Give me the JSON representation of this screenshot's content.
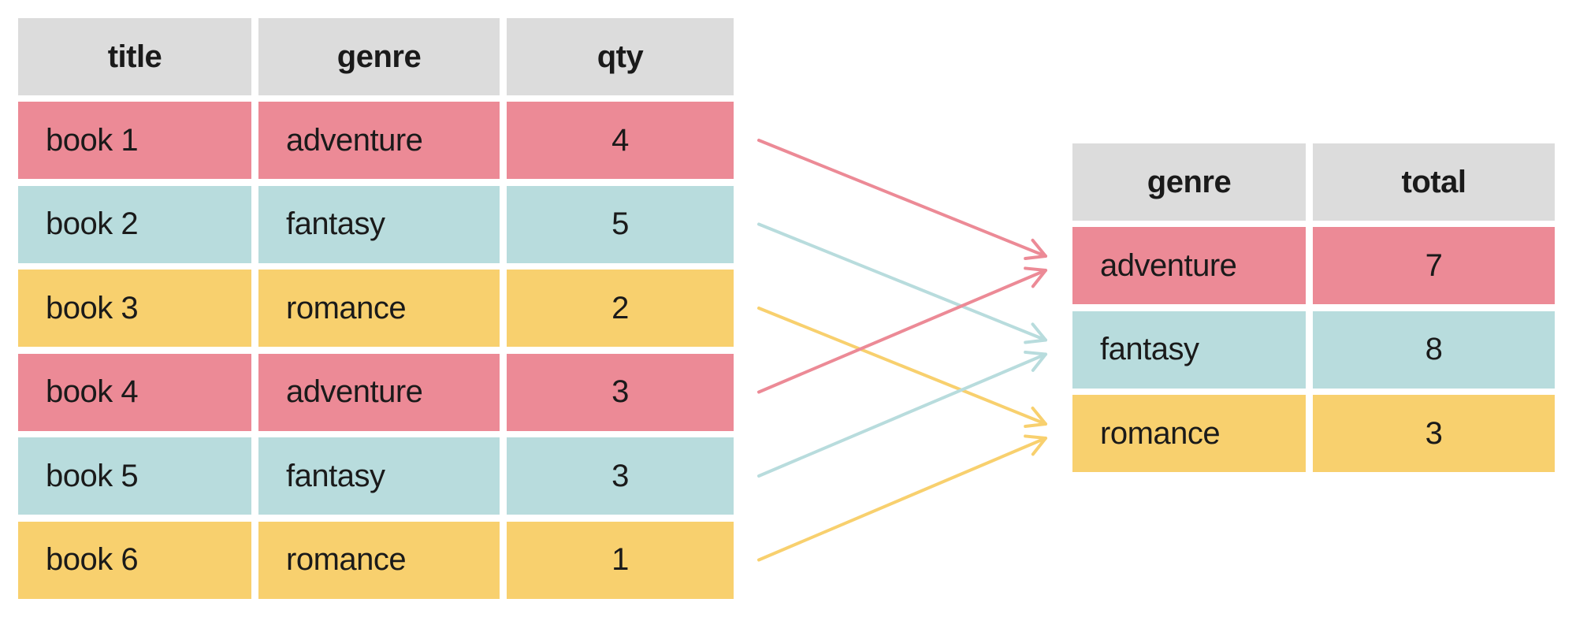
{
  "colors": {
    "header": "#dcdcdc",
    "adventure": "#ec8a96",
    "fantasy": "#b8dcdd",
    "romance": "#f8d06e"
  },
  "source_table": {
    "columns": [
      "title",
      "genre",
      "qty"
    ],
    "rows": [
      {
        "title": "book 1",
        "genre": "adventure",
        "qty": "4"
      },
      {
        "title": "book 2",
        "genre": "fantasy",
        "qty": "5"
      },
      {
        "title": "book 3",
        "genre": "romance",
        "qty": "2"
      },
      {
        "title": "book 4",
        "genre": "adventure",
        "qty": "3"
      },
      {
        "title": "book 5",
        "genre": "fantasy",
        "qty": "3"
      },
      {
        "title": "book 6",
        "genre": "romance",
        "qty": "1"
      }
    ]
  },
  "result_table": {
    "columns": [
      "genre",
      "total"
    ],
    "rows": [
      {
        "genre": "adventure",
        "total": "7"
      },
      {
        "genre": "fantasy",
        "total": "8"
      },
      {
        "genre": "romance",
        "total": "3"
      }
    ]
  },
  "arrows": [
    {
      "from_row": 0,
      "to_row": 0,
      "genre": "adventure"
    },
    {
      "from_row": 1,
      "to_row": 1,
      "genre": "fantasy"
    },
    {
      "from_row": 2,
      "to_row": 2,
      "genre": "romance"
    },
    {
      "from_row": 3,
      "to_row": 0,
      "genre": "adventure"
    },
    {
      "from_row": 4,
      "to_row": 1,
      "genre": "fantasy"
    },
    {
      "from_row": 5,
      "to_row": 2,
      "genre": "romance"
    }
  ]
}
